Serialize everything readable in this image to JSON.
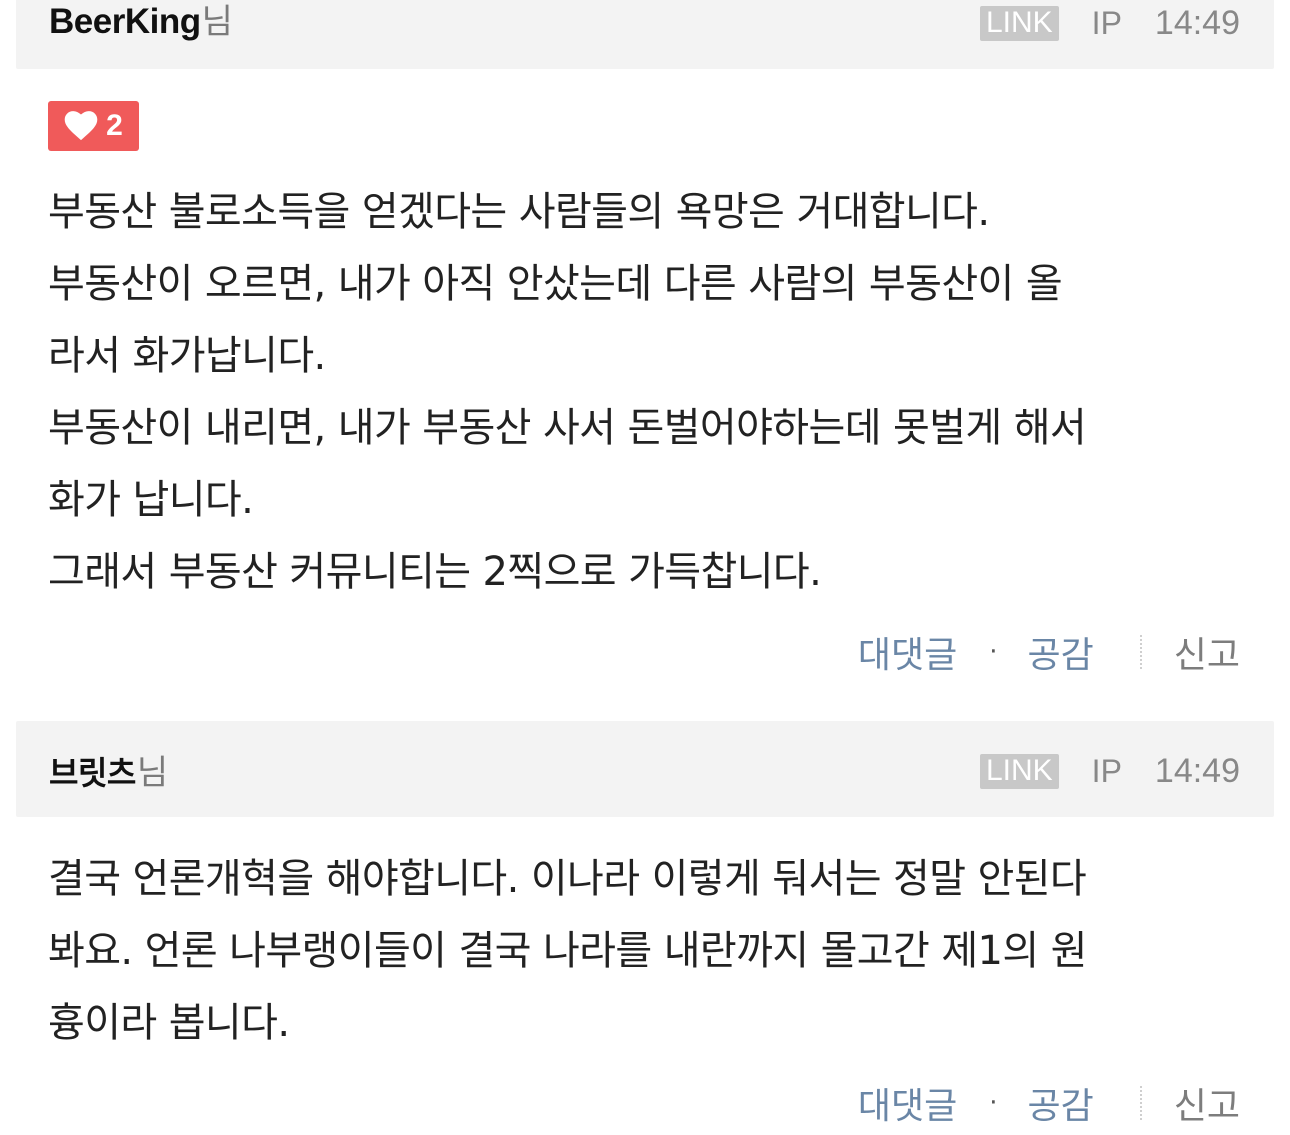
{
  "comments": [
    {
      "author": "BeerKing",
      "author_suffix": "님",
      "link_label": "LINK",
      "ip_label": "IP",
      "time": "14:49",
      "likes": "2",
      "body_lines": [
        "부동산 불로소득을 얻겠다는 사람들의 욕망은 거대합니다.",
        "부동산이 오르면, 내가 아직 안샀는데 다른 사람의 부동산이 올",
        "라서 화가납니다.",
        "부동산이 내리면, 내가 부동산 사서 돈벌어야하는데 못벌게 해서",
        "화가 납니다.",
        "그래서 부동산 커뮤니티는 2찍으로 가득찹니다."
      ],
      "actions": {
        "reply": "대댓글",
        "separator": "·",
        "agree": "공감",
        "report": "신고"
      }
    },
    {
      "author": "브릿츠",
      "author_suffix": "님",
      "link_label": "LINK",
      "ip_label": "IP",
      "time": "14:49",
      "body_lines": [
        "결국 언론개혁을 해야합니다. 이나라 이렇게 둬서는 정말 안된다",
        "봐요. 언론 나부랭이들이 결국 나라를 내란까지 몰고간 제1의 원",
        "흉이라 봅니다."
      ],
      "actions": {
        "reply": "대댓글",
        "separator": "·",
        "agree": "공감",
        "report": "신고"
      }
    }
  ],
  "colors": {
    "header_bg": "#f3f3f3",
    "like_badge": "#f05a5a",
    "link_badge": "#c8c8c8",
    "action_link": "#6a86a6",
    "meta_text": "#888888"
  },
  "icons": {
    "like": "heart-icon"
  }
}
